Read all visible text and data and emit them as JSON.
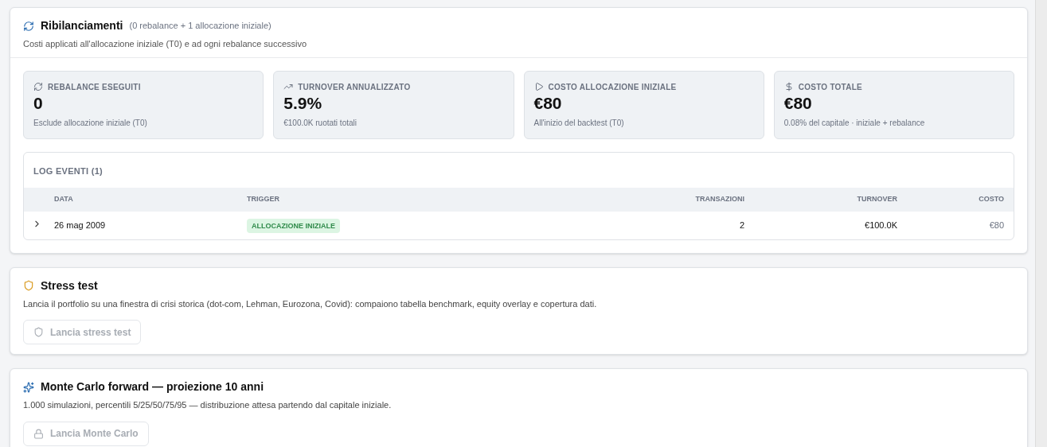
{
  "rebalancing": {
    "title": "Ribilanciamenti",
    "subtitle": "(0 rebalance + 1 allocazione iniziale)",
    "description": "Costi applicati all'allocazione iniziale (T0) e ad ogni rebalance successivo",
    "stats": [
      {
        "kind": "refresh",
        "label": "REBALANCE ESEGUITI",
        "value": "0",
        "note": "Esclude allocazione iniziale (T0)"
      },
      {
        "kind": "trend",
        "label": "TURNOVER ANNUALIZZATO",
        "value": "5.9%",
        "note": "€100.0K ruotati totali"
      },
      {
        "kind": "play",
        "label": "COSTO ALLOCAZIONE INIZIALE",
        "value": "€80",
        "note": "All'inizio del backtest (T0)"
      },
      {
        "kind": "dollar",
        "label": "COSTO TOTALE",
        "value": "€80",
        "note": "0.08% del capitale · iniziale + rebalance"
      }
    ],
    "log": {
      "title": "LOG EVENTI (1)",
      "columns": [
        "DATA",
        "TRIGGER",
        "TRANSAZIONI",
        "TURNOVER",
        "COSTO"
      ],
      "rows": [
        {
          "expanded": false,
          "date": "26 mag 2009",
          "trigger": "ALLOCAZIONE INIZIALE",
          "transactions": "2",
          "turnover": "€100.0K",
          "cost": "€80"
        }
      ]
    }
  },
  "sections": [
    {
      "kind": "shield",
      "title": "Stress test",
      "description": "Lancia il portfolio su una finestra di crisi storica (dot-com, Lehman, Eurozona, Covid): compaiono tabella benchmark, equity overlay e copertura dati.",
      "button": {
        "kind": "shield",
        "label": "Lancia stress test",
        "disabled": true
      }
    },
    {
      "kind": "sparkle",
      "title": "Monte Carlo forward — proiezione 10 anni",
      "description": "1.000 simulazioni, percentili 5/25/50/75/95 — distribuzione attesa partendo dal capitale iniziale.",
      "button": {
        "kind": "lock",
        "label": "Lancia Monte Carlo",
        "disabled": true
      }
    }
  ]
}
